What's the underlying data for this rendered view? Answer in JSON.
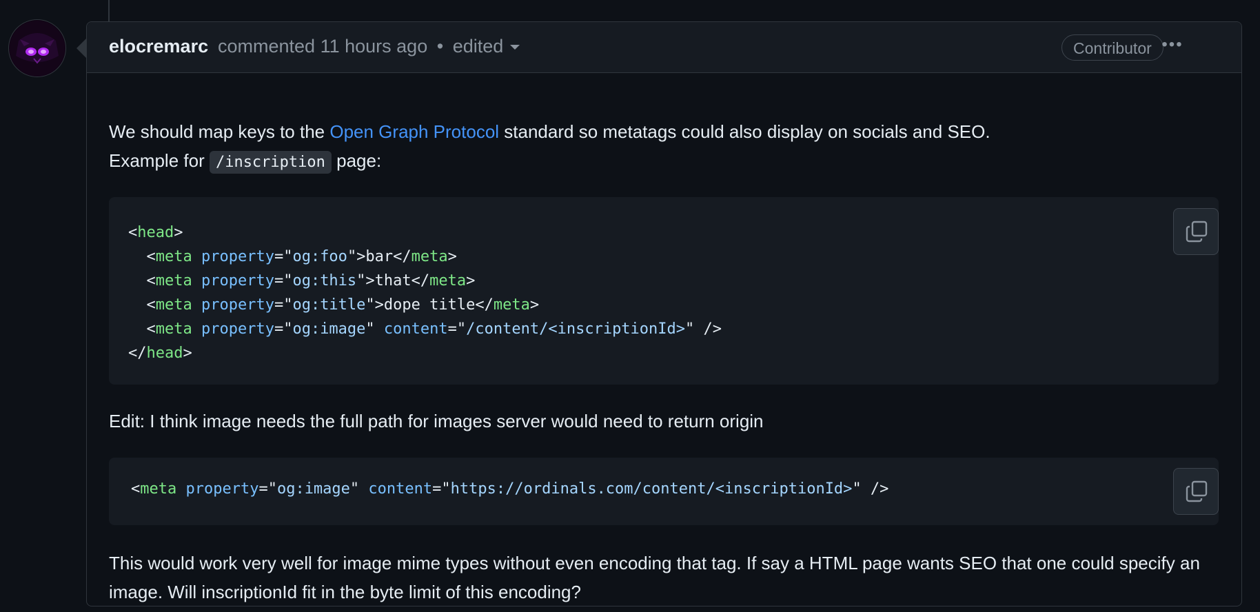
{
  "comment": {
    "author": "elocremarc",
    "action": "commented",
    "time": "11 hours ago",
    "separator": "•",
    "edited_label": "edited",
    "role_badge": "Contributor",
    "more_label": "•••"
  },
  "body": {
    "para1_before": "We should map keys to the ",
    "para1_link": "Open Graph Protocol",
    "para1_after": " standard so metatags could also display on socials and SEO.",
    "para2_before": "Example for ",
    "para2_code": "/inscription",
    "para2_after": " page:",
    "code_block_1": [
      "<head>",
      "  <meta property=\"og:foo\">bar</meta>",
      "  <meta property=\"og:this\">that</meta>",
      "  <meta property=\"og:title\">dope title</meta>",
      "  <meta property=\"og:image\" content=\"/content/<inscriptionId>\" />",
      "</head>"
    ],
    "edit_text": "Edit: I think image needs the full path for images server would need to return origin",
    "code_block_2": "<meta property=\"og:image\" content=\"https://ordinals.com/content/<inscriptionId>\" />",
    "last_para": "This would work very well for image mime types without even encoding that tag. If say a HTML page wants SEO that one could specify an image. Will inscriptionId fit in the byte limit of this encoding?"
  },
  "icons": {
    "copy": "copy-icon",
    "more": "kebab-icon",
    "dropdown": "chevron-down-icon"
  },
  "colors": {
    "background": "#0d1117",
    "link": "#4493f8",
    "tag": "#7ee787",
    "attr": "#79c0ff",
    "string": "#a5d6ff"
  }
}
